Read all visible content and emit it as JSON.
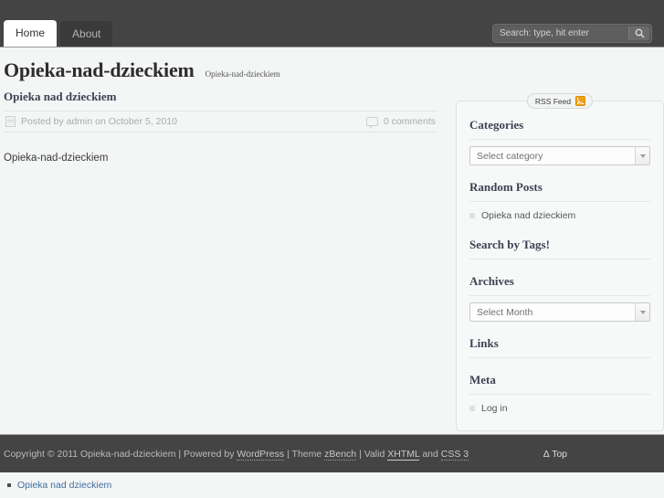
{
  "header": {
    "tabs": [
      {
        "label": "Home",
        "active": true
      },
      {
        "label": "About",
        "active": false
      }
    ],
    "search": {
      "placeholder": "Search: type, hit enter",
      "value": "",
      "icon": "search-icon"
    }
  },
  "site": {
    "title": "Opieka-nad-dzieckiem",
    "tagline": "Opieka-nad-dzieckiem"
  },
  "post": {
    "title": "Opieka nad dzieckiem",
    "meta_author": "Posted by admin on October 5, 2010",
    "meta_comments": "0 comments",
    "body": "Opieka-nad-dzieckiem",
    "calendar_icon": "calendar-icon",
    "comment_icon": "comment-bubble-icon"
  },
  "sidebar": {
    "rss": {
      "label": "RSS Feed",
      "icon": "rss-icon"
    },
    "widgets": [
      {
        "title": "Categories",
        "type": "select",
        "select_value": "Select category"
      },
      {
        "title": "Random Posts",
        "type": "list",
        "items": [
          "Opieka nad dzieckiem"
        ]
      },
      {
        "title": "Search by Tags!",
        "type": "empty"
      },
      {
        "title": "Archives",
        "type": "select",
        "select_value": "Select Month"
      },
      {
        "title": "Links",
        "type": "empty"
      },
      {
        "title": "Meta",
        "type": "list",
        "items": [
          "Log in"
        ]
      }
    ]
  },
  "footer": {
    "copyright_prefix": "Copyright © 2011 Opieka-nad-dzieckiem",
    "sep1": " | Powered by ",
    "wordpress": "WordPress",
    "sep2": " | Theme ",
    "theme": "zBench",
    "sep3": " | Valid ",
    "xhtml": "XHTML",
    "sep4": " and ",
    "css": "CSS 3",
    "top_label": "Δ Top"
  },
  "bottom": {
    "link": "Opieka nad dzieckiem"
  },
  "colors": {
    "header_bg": "#444444",
    "page_bg": "#f4f5f5",
    "heading": "#3d4354",
    "link_blue": "#3f6f9f",
    "rss_orange": "#f0a017"
  }
}
